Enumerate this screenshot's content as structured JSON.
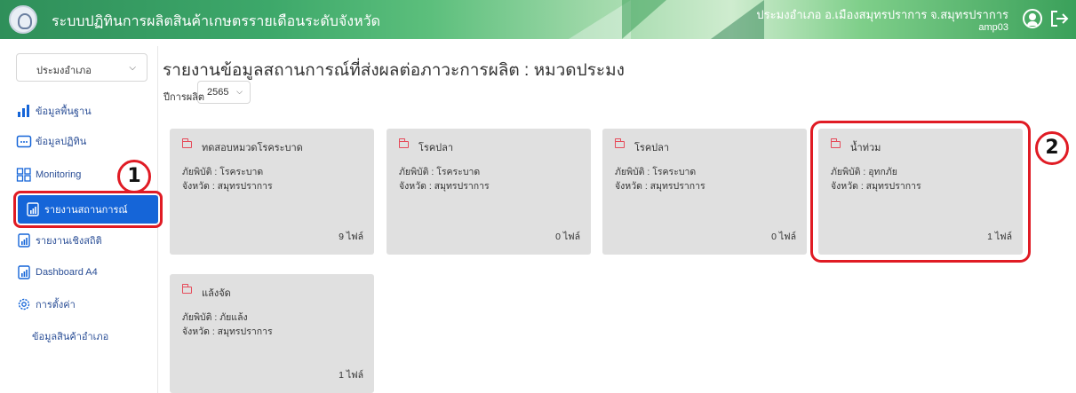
{
  "header": {
    "app_title": "ระบบปฏิทินการผลิตสินค้าเกษตรรายเดือนระดับจังหวัด",
    "user_location": "ประมงอำเภอ อ.เมืองสมุทรปราการ จ.สมุทรปราการ",
    "user_code": "amp03"
  },
  "sidebar": {
    "role_select": "ประมงอำเภอ",
    "items": [
      {
        "label": "ข้อมูลพื้นฐาน",
        "icon": "bar-chart-icon"
      },
      {
        "label": "ข้อมูลปฏิทิน",
        "icon": "calendar-icon"
      },
      {
        "label": "Monitoring",
        "icon": "grid-icon"
      },
      {
        "label": "รายงานสถานการณ์",
        "icon": "report-icon"
      },
      {
        "label": "รายงานเชิงสถิติ",
        "icon": "report-icon"
      },
      {
        "label": "Dashboard A4",
        "icon": "report-icon"
      },
      {
        "label": "การตั้งค่า",
        "icon": "gear-icon"
      }
    ],
    "sub_item": "ข้อมูลสินค้าอำเภอ"
  },
  "main": {
    "title": "รายงานข้อมูลสถานการณ์ที่ส่งผลต่อภาวะการผลิต : หมวดประมง",
    "year_label": "ปีการผลิต",
    "year_value": "2565",
    "cards": [
      {
        "name": "ทดสอบหมวดโรคระบาด",
        "hazard": "ภัยพิบัติ : โรคระบาด",
        "province": "จังหวัด : สมุทรปราการ",
        "files": "9 ไฟล์"
      },
      {
        "name": "โรคปลา",
        "hazard": "ภัยพิบัติ : โรคระบาด",
        "province": "จังหวัด : สมุทรปราการ",
        "files": "0 ไฟล์"
      },
      {
        "name": "โรคปลา",
        "hazard": "ภัยพิบัติ : โรคระบาด",
        "province": "จังหวัด : สมุทรปราการ",
        "files": "0 ไฟล์"
      },
      {
        "name": "น้ำท่วม",
        "hazard": "ภัยพิบัติ : อุทกภัย",
        "province": "จังหวัด : สมุทรปราการ",
        "files": "1 ไฟล์"
      },
      {
        "name": "แล้งจัด",
        "hazard": "ภัยพิบัติ : ภัยแล้ง",
        "province": "จังหวัด : สมุทรปราการ",
        "files": "1 ไฟล์"
      }
    ]
  },
  "annotations": {
    "step1": "1",
    "step2": "2",
    "marker_color": "#e01b24"
  },
  "colors": {
    "header_green": "#3da86a",
    "active_blue": "#1565d8",
    "nav_blue": "#2a4e96",
    "card_bg": "#e0e0e0",
    "folder_red": "#e64b5a"
  }
}
